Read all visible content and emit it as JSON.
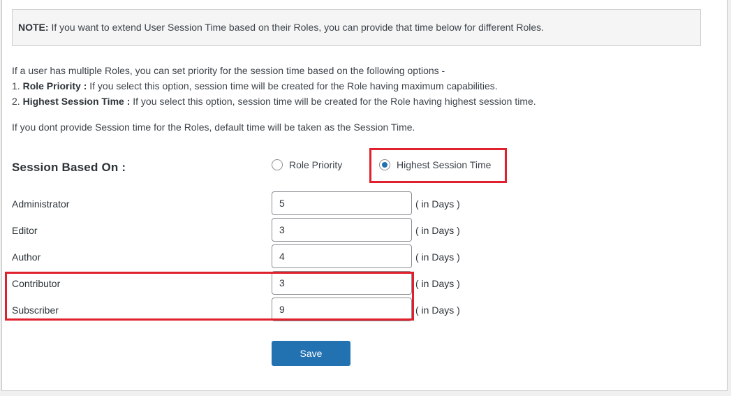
{
  "note": {
    "label": "NOTE:",
    "text": " If you want to extend User Session Time based on their Roles, you can provide that time below for different Roles."
  },
  "description": {
    "intro": "If a user has multiple Roles, you can set priority for the session time based on the following options -",
    "option1_prefix": "1. ",
    "option1_label": "Role Priority :",
    "option1_text": " If you select this option, session time will be created for the Role having maximum capabilities.",
    "option2_prefix": "2. ",
    "option2_label": "Highest Session Time :",
    "option2_text": " If you select this option, session time will be created for the Role having highest session time.",
    "default_note": "If you dont provide Session time for the Roles, default time will be taken as the Session Time."
  },
  "session_based_on": {
    "label": "Session Based On :",
    "options": [
      {
        "label": "Role Priority",
        "checked": false
      },
      {
        "label": "Highest Session Time",
        "checked": true
      }
    ]
  },
  "roles": [
    {
      "name": "Administrator",
      "value": "5",
      "unit": "( in Days )"
    },
    {
      "name": "Editor",
      "value": "3",
      "unit": "( in Days )"
    },
    {
      "name": "Author",
      "value": "4",
      "unit": "( in Days )"
    },
    {
      "name": "Contributor",
      "value": "3",
      "unit": "( in Days )"
    },
    {
      "name": "Subscriber",
      "value": "9",
      "unit": "( in Days )"
    }
  ],
  "save_label": "Save",
  "colors": {
    "accent": "#2271b1",
    "highlight": "#e0202c"
  }
}
